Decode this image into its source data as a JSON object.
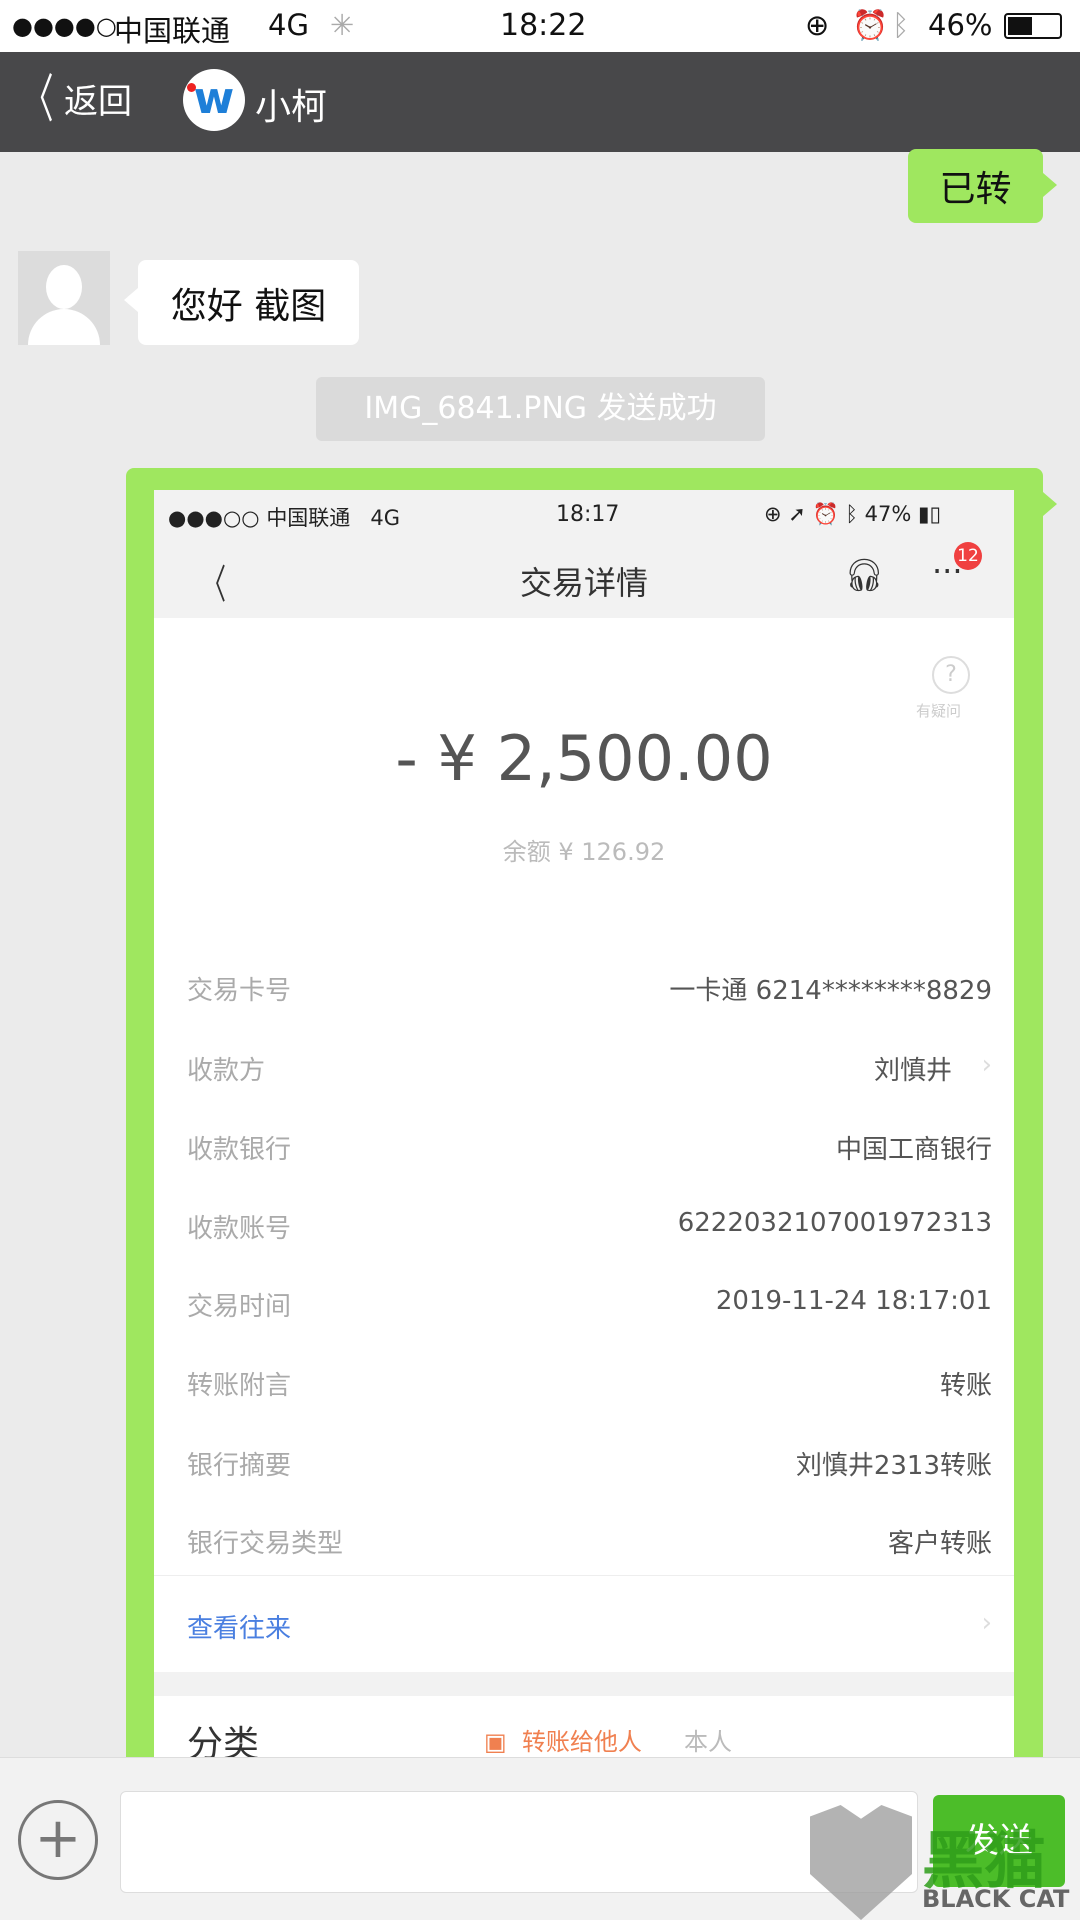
{
  "status_bar": {
    "signal": "●●●●○",
    "carrier": "中国联通",
    "network": "4G",
    "time": "18:22",
    "battery": "46%"
  },
  "nav": {
    "back_label": "返回",
    "contact_name": "小柯"
  },
  "messages": [
    {
      "from": "me",
      "text": "已转"
    },
    {
      "from": "other",
      "text": "您好 截图"
    },
    {
      "type": "system",
      "text": "IMG_6841.PNG 发送成功"
    }
  ],
  "screenshot": {
    "status_bar": {
      "signal": "●●●○○",
      "carrier": "中国联通",
      "network": "4G",
      "time": "18:17",
      "battery": "47%"
    },
    "title": "交易详情",
    "more_badge": "12",
    "help_label": "有疑问",
    "amount": "- ¥  2,500.00",
    "balance": "余额 ¥ 126.92",
    "rows": [
      {
        "label": "交易卡号",
        "value": "一卡通 6214********8829"
      },
      {
        "label": "收款方",
        "value": "刘慎井"
      },
      {
        "label": "收款银行",
        "value": "中国工商银行"
      },
      {
        "label": "收款账号",
        "value": "6222032107001972313"
      },
      {
        "label": "交易时间",
        "value": "2019-11-24 18:17:01"
      },
      {
        "label": "转账附言",
        "value": "转账"
      },
      {
        "label": "银行摘要",
        "value": "刘慎井2313转账"
      },
      {
        "label": "银行交易类型",
        "value": "客户转账"
      }
    ],
    "history_link": "查看往来",
    "category_label": "分类",
    "category_value": "转账给他人",
    "category_extra": "本人"
  },
  "input_bar": {
    "placeholder": "",
    "send_label": "发送"
  },
  "watermark": {
    "cn": "黑猫",
    "en": "BLACK CAT"
  },
  "colors": {
    "bubble_green": "#9fe75f",
    "nav_bg": "#48484a",
    "link_blue": "#4a7fe0",
    "badge_red": "#f04040",
    "category_orange": "#f08050"
  }
}
